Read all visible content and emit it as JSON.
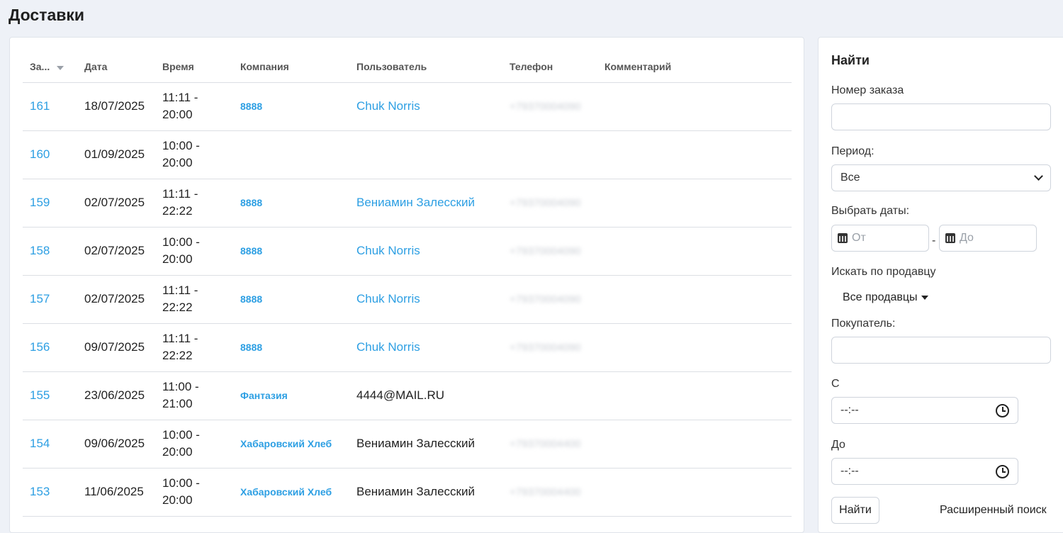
{
  "page": {
    "title": "Доставки"
  },
  "table": {
    "headers": {
      "order": "За...",
      "date": "Дата",
      "time": "Время",
      "company": "Компания",
      "user": "Пользователь",
      "phone": "Телефон",
      "comment": "Комментарий"
    },
    "rows": [
      {
        "order": "161",
        "date": "18/07/2025",
        "time_from": "11:11 -",
        "time_to": "20:00",
        "company": "8888",
        "user": "Chuk Norris",
        "user_link": true,
        "phone": "+79370004090",
        "comment": ""
      },
      {
        "order": "160",
        "date": "01/09/2025",
        "time_from": "10:00 -",
        "time_to": "20:00",
        "company": "",
        "user": "",
        "user_link": false,
        "phone": "",
        "comment": ""
      },
      {
        "order": "159",
        "date": "02/07/2025",
        "time_from": "11:11 -",
        "time_to": "22:22",
        "company": "8888",
        "user": "Вениамин Залесский",
        "user_link": true,
        "phone": "+79370004090",
        "comment": ""
      },
      {
        "order": "158",
        "date": "02/07/2025",
        "time_from": "10:00 -",
        "time_to": "20:00",
        "company": "8888",
        "user": "Chuk Norris",
        "user_link": true,
        "phone": "+79370004090",
        "comment": ""
      },
      {
        "order": "157",
        "date": "02/07/2025",
        "time_from": "11:11 -",
        "time_to": "22:22",
        "company": "8888",
        "user": "Chuk Norris",
        "user_link": true,
        "phone": "+79370004090",
        "comment": ""
      },
      {
        "order": "156",
        "date": "09/07/2025",
        "time_from": "11:11 -",
        "time_to": "22:22",
        "company": "8888",
        "user": "Chuk Norris",
        "user_link": true,
        "phone": "+79370004090",
        "comment": ""
      },
      {
        "order": "155",
        "date": "23/06/2025",
        "time_from": "11:00 -",
        "time_to": "21:00",
        "company": "Фантазия",
        "user": "4444@MAIL.RU",
        "user_link": false,
        "phone": "",
        "comment": ""
      },
      {
        "order": "154",
        "date": "09/06/2025",
        "time_from": "10:00 -",
        "time_to": "20:00",
        "company": "Хабаровский Хлеб",
        "user": "Вениамин Залесский",
        "user_link": false,
        "phone": "+79370004400",
        "comment": ""
      },
      {
        "order": "153",
        "date": "11/06/2025",
        "time_from": "10:00 -",
        "time_to": "20:00",
        "company": "Хабаровский Хлеб",
        "user": "Вениамин Залесский",
        "user_link": false,
        "phone": "+79370004400",
        "comment": ""
      }
    ]
  },
  "search": {
    "title": "Найти",
    "order_label": "Номер заказа",
    "order_value": "",
    "period_label": "Период:",
    "period_selected": "Все",
    "dates_label": "Выбрать даты:",
    "date_from_placeholder": "От",
    "date_separator": "-",
    "date_to_placeholder": "До",
    "seller_label": "Искать по продавцу",
    "seller_selected": "Все продавцы",
    "buyer_label": "Покупатель:",
    "buyer_value": "",
    "time_from_label": "С",
    "time_from_value": "--:--",
    "time_to_label": "До",
    "time_to_value": "--:--",
    "find_button": "Найти",
    "advanced_link": "Расширенный поиск"
  }
}
